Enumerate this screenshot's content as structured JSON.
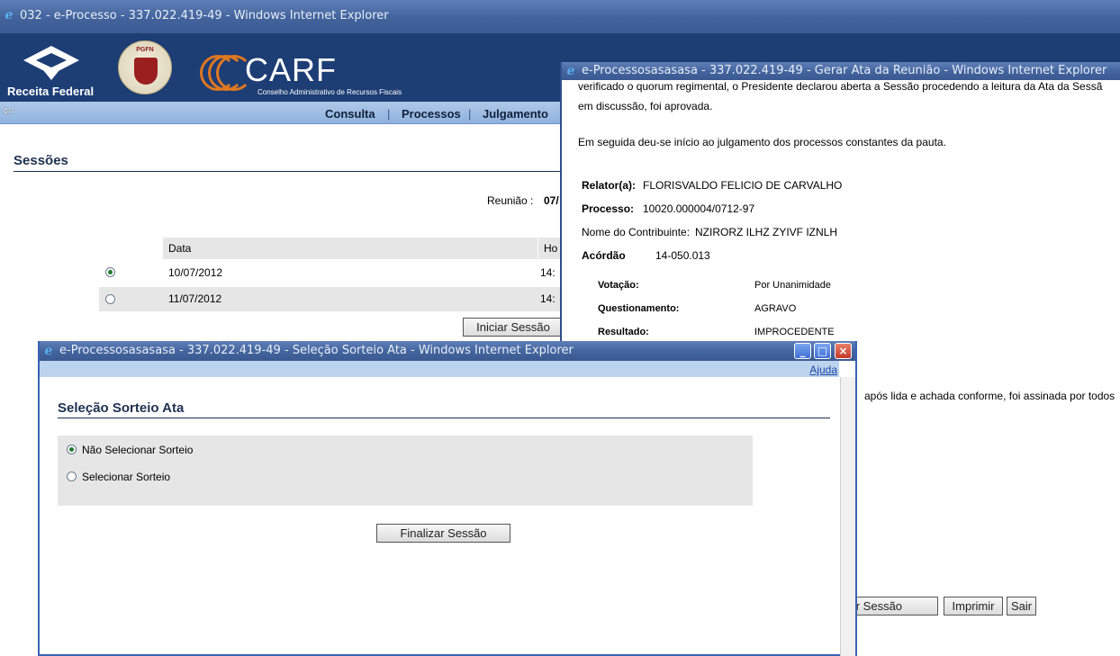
{
  "main_window": {
    "title": "032 - e-Processo - 337.022.419-49 - Windows Internet Explorer",
    "logos": {
      "receita": "Receita Federal",
      "pgfn": "PGFN",
      "carf": "CARF",
      "carf_subtitle": "Conselho Administrativo de Recursos Fiscais"
    },
    "nav": [
      "Consulta",
      "Processos",
      "Julgamento"
    ],
    "page_title": "Sessões",
    "reuniao_label": "Reunião :",
    "reuniao_value": "07/",
    "table": {
      "headers": [
        "Data",
        "Ho"
      ],
      "rows": [
        {
          "date": "10/07/2012",
          "hour": "14:",
          "selected": true
        },
        {
          "date": "11/07/2012",
          "hour": "14:",
          "selected": false
        }
      ]
    },
    "start_button": "Iniciar Sessão"
  },
  "ata_window": {
    "title": "e-Processosasasasa - 337.022.419-49 - Gerar Ata da Reunião - Windows Internet Explorer",
    "text_top": "verificado o quorum regimental, o Presidente declarou aberta a Sessão procedendo a leitura da Ata da Sessã",
    "text_approved": "em discussão, foi aprovada.",
    "text_followed": "Em seguida deu-se início ao julgamento dos processos constantes da pauta.",
    "relator_label": "Relator(a):",
    "relator_value": "FLORISVALDO FELICIO DE CARVALHO",
    "processo_label": "Processo:",
    "processo_value": "10020.000004/0712-97",
    "contribuinte_label": "Nome do Contribuinte:",
    "contribuinte_value": "NZIRORZ ILHZ ZYIVF IZNLH",
    "acordao_label": "Acórdão",
    "acordao_value": "14-050.013",
    "votacao_label": "Votação:",
    "votacao_value": "Por Unanimidade",
    "questionamento_label": "Questionamento:",
    "questionamento_value": "AGRAVO",
    "resultado_label": "Resultado:",
    "resultado_value": "IMPROCEDENTE",
    "text_closing": "após lida e achada conforme, foi assinada por todos",
    "buttons": {
      "finalizar_partial": "zar Sessão",
      "imprimir": "Imprimir",
      "sair": "Sair"
    }
  },
  "sorteio_window": {
    "title": "e-Processosasasasa - 337.022.419-49 - Seleção Sorteio Ata - Windows Internet Explorer",
    "help_link": "Ajuda",
    "heading": "Seleção Sorteio Ata",
    "options": [
      {
        "label": "Não Selecionar Sorteio",
        "selected": true
      },
      {
        "label": "Selecionar Sorteio",
        "selected": false
      }
    ],
    "finalize_button": "Finalizar Sessão"
  },
  "colors": {
    "header_blue": "#1d3d75",
    "titlebar_blue": "#42639c",
    "carf_orange": "#e07820",
    "radio_green": "#1e7b2d"
  }
}
